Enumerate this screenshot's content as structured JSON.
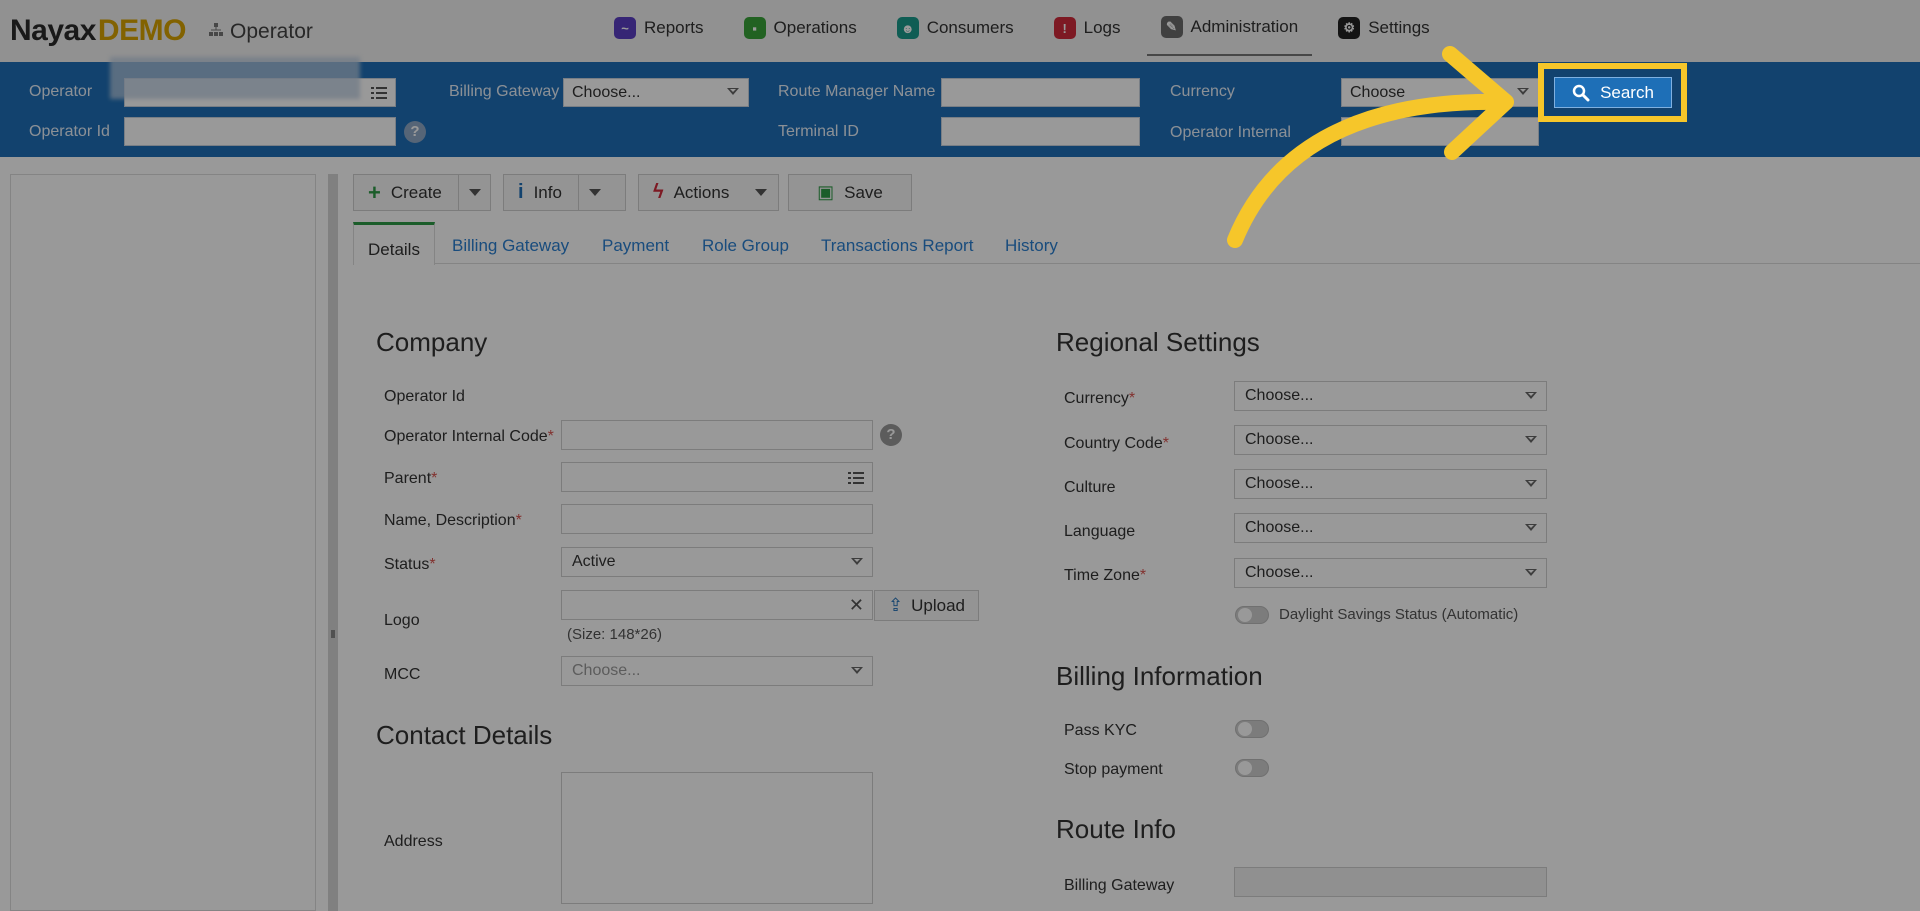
{
  "brand": {
    "logo_main": "Nayax",
    "logo_demo": "DEMO",
    "app_name": "Operator"
  },
  "nav": [
    {
      "label": "Reports",
      "icon": "reports-icon",
      "color": "#5b3fc4"
    },
    {
      "label": "Operations",
      "icon": "operations-icon",
      "color": "#3aa33a"
    },
    {
      "label": "Consumers",
      "icon": "consumers-icon",
      "color": "#1a9b8c"
    },
    {
      "label": "Logs",
      "icon": "logs-icon",
      "color": "#d12b3b"
    },
    {
      "label": "Administration",
      "icon": "administration-icon",
      "color": "#6b6b6b",
      "active": true
    },
    {
      "label": "Settings",
      "icon": "settings-icon",
      "color": "#222222"
    }
  ],
  "search": {
    "operator_label": "Operator",
    "operator_id_label": "Operator Id",
    "billing_gateway_label": "Billing Gateway",
    "billing_gateway_value": "Choose...",
    "route_manager_label": "Route Manager Name",
    "terminal_id_label": "Terminal ID",
    "currency_label": "Currency",
    "currency_value": "Choose",
    "operator_internal_label": "Operator Internal",
    "search_button": "Search"
  },
  "toolbar": {
    "create": "Create",
    "info": "Info",
    "actions": "Actions",
    "save": "Save"
  },
  "tabs": [
    "Details",
    "Billing Gateway",
    "Payment",
    "Role Group",
    "Transactions Report",
    "History"
  ],
  "company": {
    "title": "Company",
    "operator_id_label": "Operator Id",
    "internal_code_label": "Operator Internal Code",
    "parent_label": "Parent",
    "name_label": "Name, Description",
    "status_label": "Status",
    "status_value": "Active",
    "logo_label": "Logo",
    "upload_label": "Upload",
    "logo_size_note": "(Size: 148*26)",
    "mcc_label": "MCC",
    "mcc_placeholder": "Choose..."
  },
  "contact": {
    "title": "Contact Details",
    "address_label": "Address"
  },
  "regional": {
    "title": "Regional Settings",
    "currency_label": "Currency",
    "country_label": "Country Code",
    "culture_label": "Culture",
    "language_label": "Language",
    "timezone_label": "Time Zone",
    "choose": "Choose...",
    "daylight_label": "Daylight Savings Status (Automatic)"
  },
  "billing": {
    "title": "Billing Information",
    "pass_kyc_label": "Pass KYC",
    "stop_payment_label": "Stop payment"
  },
  "route": {
    "title": "Route Info",
    "billing_gateway_label": "Billing Gateway"
  },
  "colors": {
    "header_blue": "#1e6fb7",
    "highlight": "#f6c62a",
    "tab_active": "#2e9b46",
    "link": "#2a7fd0"
  }
}
